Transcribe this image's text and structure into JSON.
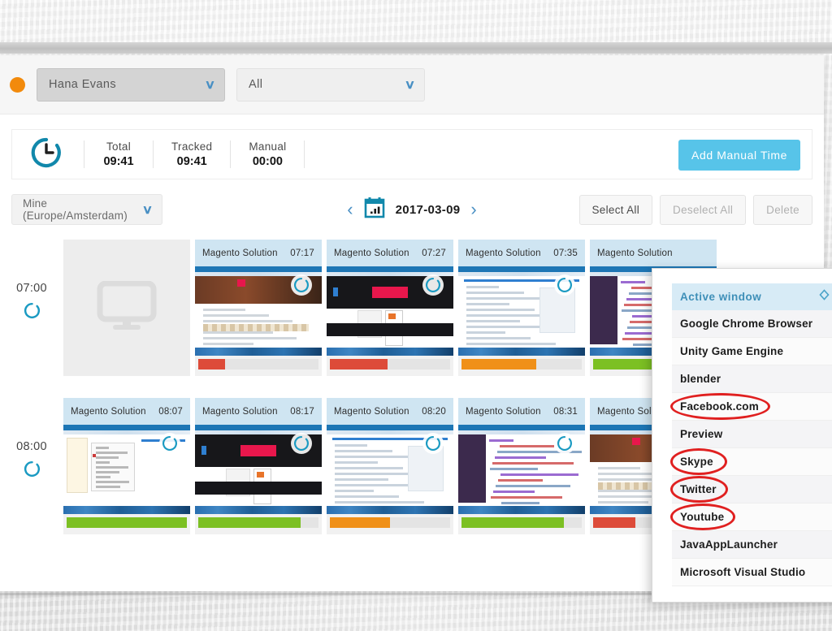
{
  "filter_bar": {
    "status_dot_color": "#f28a0c",
    "user_select": {
      "value": "Hana Evans",
      "chevron": "chevron-down-icon"
    },
    "project_select": {
      "value": "All",
      "chevron": "chevron-down-icon"
    }
  },
  "totals": {
    "clock_icon": "clock-icon",
    "stats": [
      {
        "label": "Total",
        "value": "09:41"
      },
      {
        "label": "Tracked",
        "value": "09:41"
      },
      {
        "label": "Manual",
        "value": "00:00"
      }
    ],
    "add_manual_label": "Add Manual Time",
    "accent_color": "#57c4e9"
  },
  "toolbar": {
    "timezone": "Mine (Europe/Amsterdam)",
    "prev_label": "‹",
    "next_label": "›",
    "calendar_icon": "calendar-icon",
    "date": "2017-03-09",
    "select_all": "Select All",
    "deselect_all": "Deselect All",
    "delete": "Delete"
  },
  "timeline": {
    "rows": [
      {
        "hour": "07:00",
        "spinner_icon": "loading-spinner-icon",
        "placeholder_icon": "monitor-icon",
        "has_placeholder": true,
        "shots": [
          {
            "title": "Magento Solution",
            "time": "07:17",
            "activity_pct": 22,
            "activity_color": "#dd4b39",
            "theme": "article"
          },
          {
            "title": "Magento Solution",
            "time": "07:27",
            "activity_pct": 48,
            "activity_color": "#dd4b39",
            "theme": "dark-hero"
          },
          {
            "title": "Magento Solution",
            "time": "07:35",
            "activity_pct": 62,
            "activity_color": "#f09018",
            "theme": "doc"
          },
          {
            "title": "Magento Solution",
            "time": "",
            "activity_pct": 100,
            "activity_color": "#7cc023",
            "theme": "code"
          }
        ]
      },
      {
        "hour": "08:00",
        "spinner_icon": "loading-spinner-icon",
        "has_placeholder": false,
        "shots": [
          {
            "title": "Magento Solution",
            "time": "08:07",
            "activity_pct": 100,
            "activity_color": "#7cc023",
            "theme": "ide"
          },
          {
            "title": "Magento Solution",
            "time": "08:17",
            "activity_pct": 85,
            "activity_color": "#7cc023",
            "theme": "dark-hero"
          },
          {
            "title": "Magento Solution",
            "time": "08:20",
            "activity_pct": 50,
            "activity_color": "#f09018",
            "theme": "doc"
          },
          {
            "title": "Magento Solution",
            "time": "08:31",
            "activity_pct": 85,
            "activity_color": "#7cc023",
            "theme": "code"
          },
          {
            "title": "Magento Solution",
            "time": "",
            "activity_pct": 35,
            "activity_color": "#dd4b39",
            "theme": "article"
          }
        ]
      }
    ]
  },
  "dropdown": {
    "header": {
      "label": "Active window",
      "sort_icon": "sort-chevron-icon"
    },
    "items": [
      {
        "label": "Google Chrome Browser",
        "highlighted": false
      },
      {
        "label": "Unity Game Engine",
        "highlighted": false
      },
      {
        "label": "blender",
        "highlighted": false
      },
      {
        "label": "Facebook.com",
        "highlighted": true
      },
      {
        "label": "Preview",
        "highlighted": false
      },
      {
        "label": "Skype",
        "highlighted": true
      },
      {
        "label": "Twitter",
        "highlighted": true
      },
      {
        "label": "Youtube",
        "highlighted": true
      },
      {
        "label": "JavaAppLauncher",
        "highlighted": false
      },
      {
        "label": "Microsoft Visual Studio",
        "highlighted": false
      }
    ],
    "annotation_color": "#e02020"
  }
}
